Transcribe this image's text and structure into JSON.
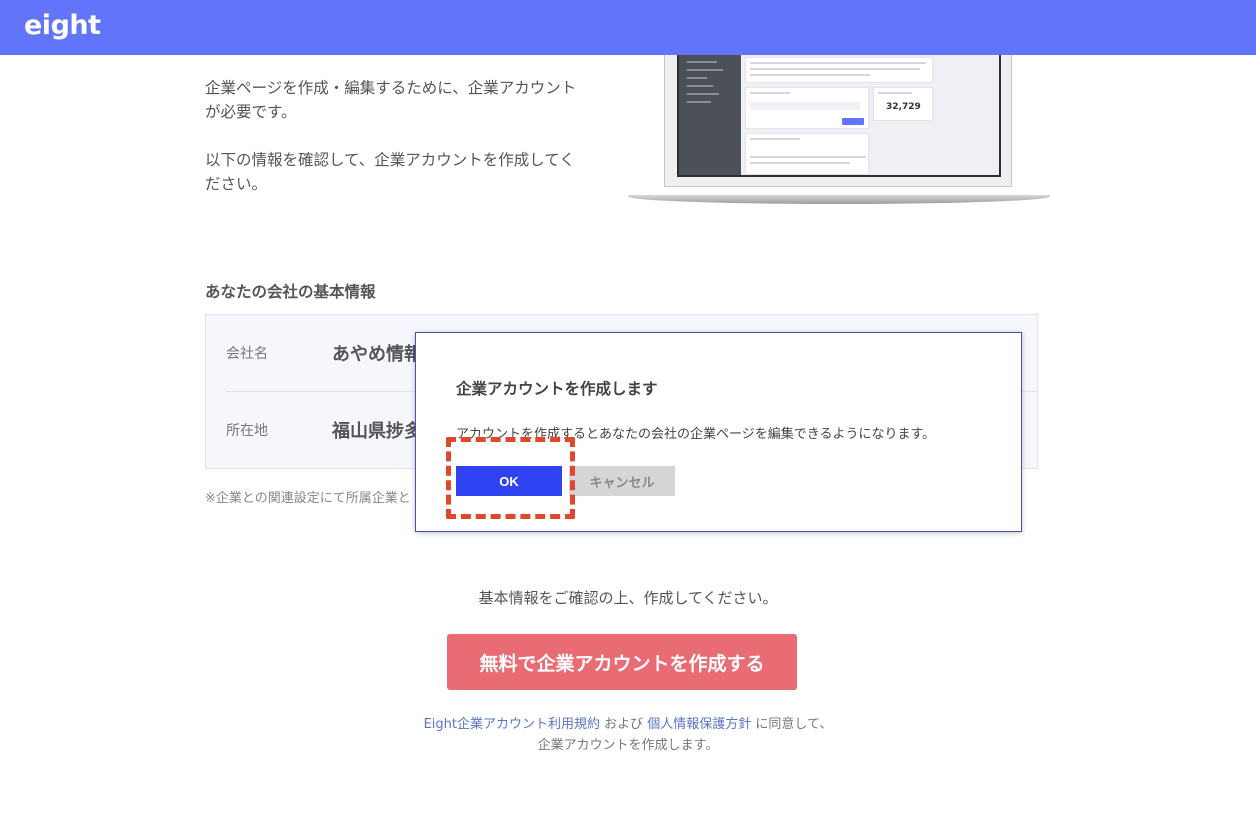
{
  "header": {
    "logo": "eight"
  },
  "intro": {
    "paragraph1": "企業ページを作成・編集するために、企業アカウントが必要です。",
    "paragraph2": "以下の情報を確認して、企業アカウントを作成してください。"
  },
  "illustration": {
    "follower_count": "32,729"
  },
  "company_info": {
    "title": "あなたの会社の基本情報",
    "rows": [
      {
        "label": "会社名",
        "value": "あやめ情報"
      },
      {
        "label": "所在地",
        "value": "福山県捗多"
      }
    ],
    "note": "※企業との関連設定にて所属企業と"
  },
  "dialog": {
    "title": "企業アカウントを作成します",
    "message": "アカウントを作成するとあなたの会社の企業ページを編集できるようになります。",
    "ok_label": "OK",
    "cancel_label": "キャンセル"
  },
  "cta": {
    "prompt": "基本情報をご確認の上、作成してください。",
    "button_label": "無料で企業アカウントを作成する"
  },
  "terms": {
    "link1": "Eight企業アカウント利用規約",
    "and_text": " および ",
    "link2": "個人情報保護方針",
    "agree_text": " に同意して、",
    "line2": "企業アカウントを作成します。"
  },
  "colors": {
    "header": "#6274fa",
    "ok_button": "#2f43f2",
    "cta_button": "#e96b73",
    "highlight": "#e0472c",
    "link": "#5b74c9"
  }
}
